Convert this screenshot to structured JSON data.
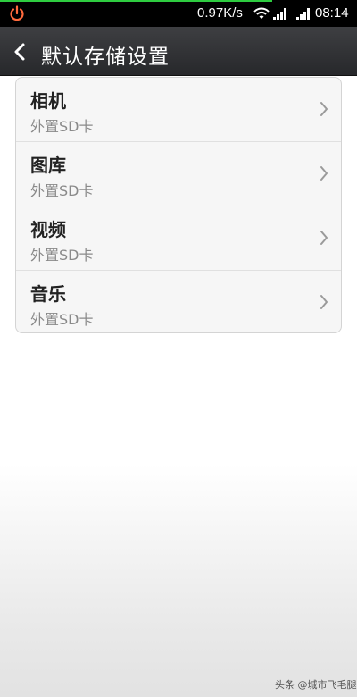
{
  "status_bar": {
    "network_speed": "0.97K/s",
    "time": "08:14",
    "icons": [
      "power-icon",
      "wifi-icon",
      "signal-icon",
      "signal-icon"
    ]
  },
  "header": {
    "title": "默认存储设置",
    "back_icon": "back-arrow-icon"
  },
  "settings": {
    "items": [
      {
        "title": "相机",
        "value": "外置SD卡"
      },
      {
        "title": "图库",
        "value": "外置SD卡"
      },
      {
        "title": "视频",
        "value": "外置SD卡"
      },
      {
        "title": "音乐",
        "value": "外置SD卡"
      }
    ]
  },
  "watermark": "头条 @城市飞毛腿",
  "colors": {
    "status_bar_bg": "#000000",
    "title_bar_bg": "#2f3033",
    "accent_green": "#2ecc40",
    "card_bg": "#f6f6f6",
    "subtitle": "#8a8a8a"
  }
}
